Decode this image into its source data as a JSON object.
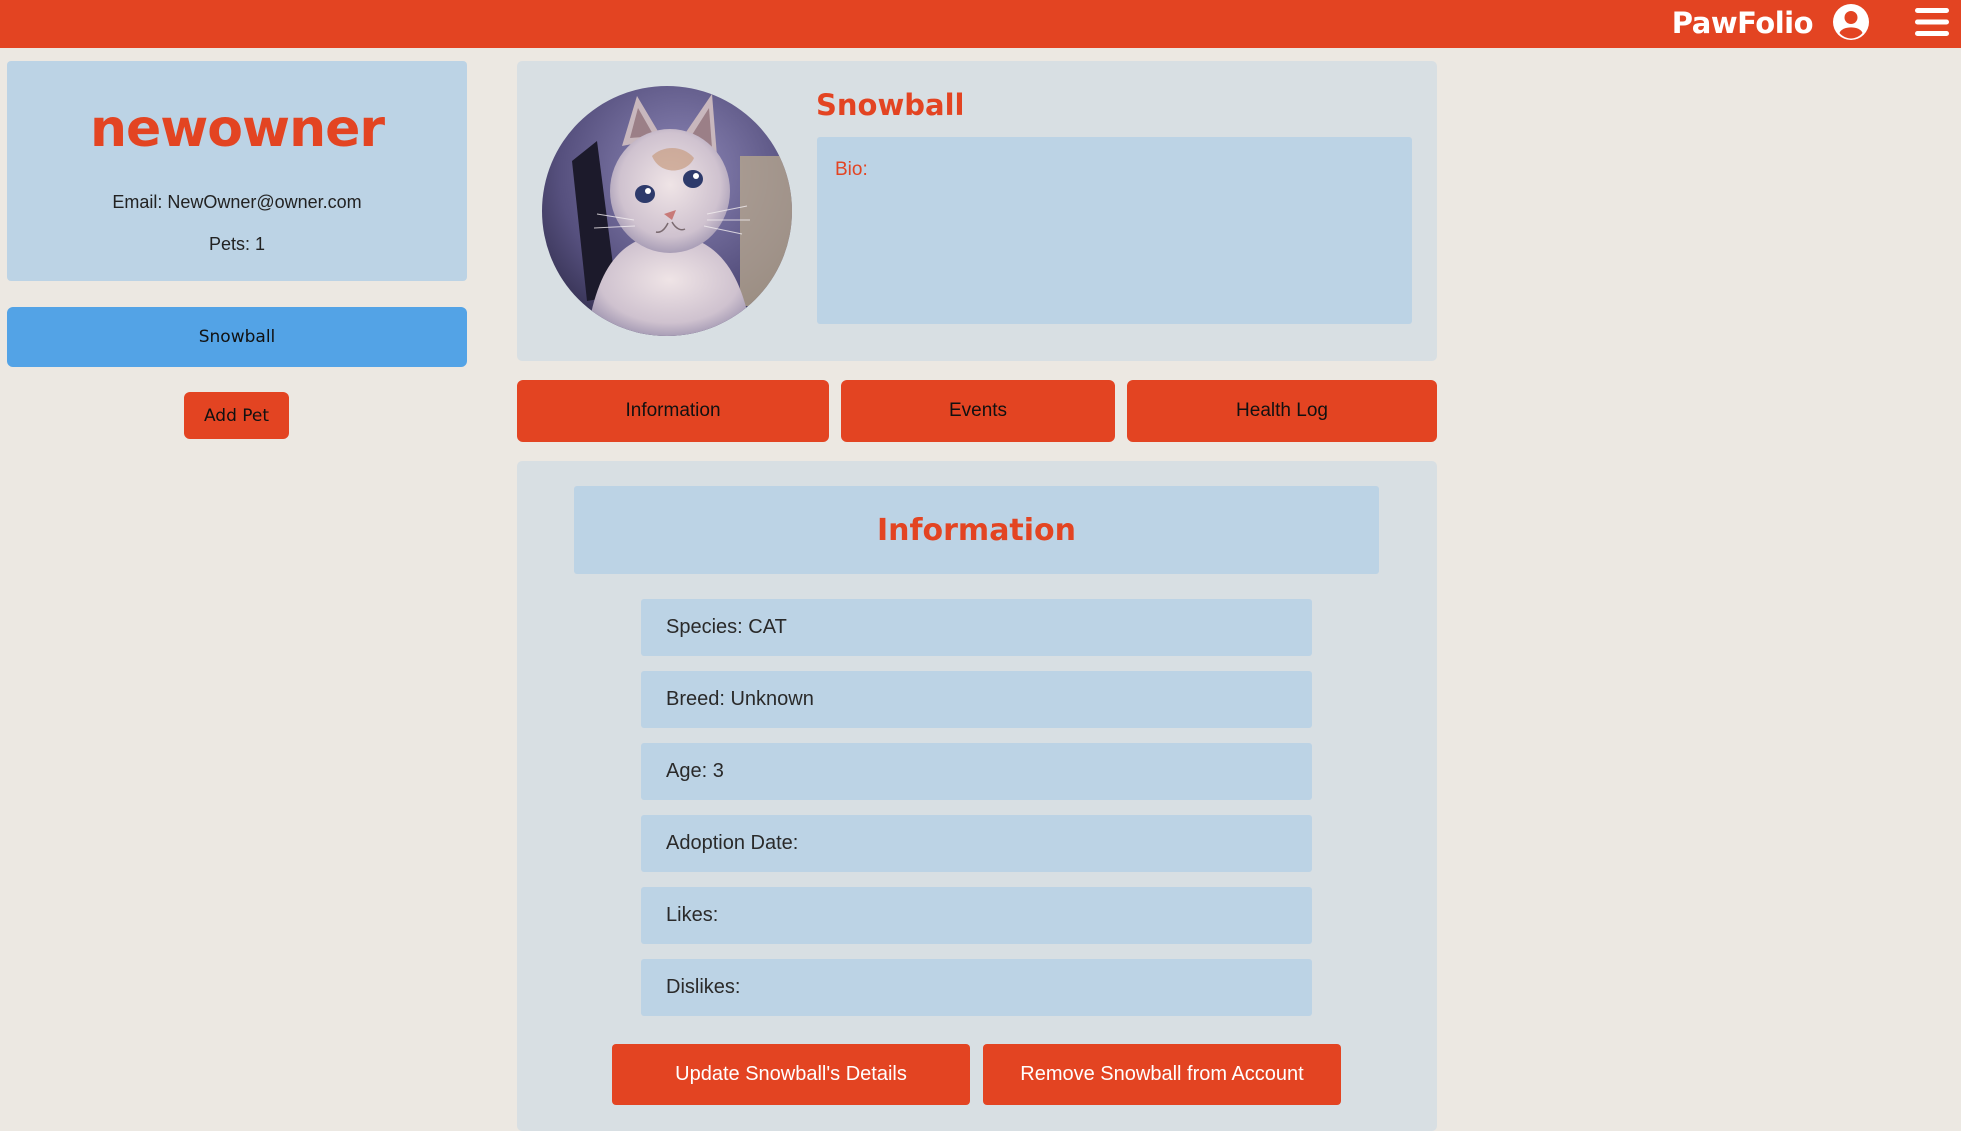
{
  "header": {
    "brand": "PawFolio",
    "icons": [
      "user-circle-icon",
      "hamburger-menu-icon"
    ],
    "accent_color": "#e34422"
  },
  "owner": {
    "name": "newowner",
    "email": "Email: NewOwner@owner.com",
    "pets": "Pets: 1"
  },
  "sidebar": {
    "pet_tabs": [
      {
        "label": "Snowball",
        "selected": true
      }
    ],
    "add_pet_label": "Add Pet"
  },
  "profile": {
    "pet_name": "Snowball",
    "bio_label": "Bio:",
    "photo_alt": "cat photo"
  },
  "tabs": [
    {
      "label": "Information"
    },
    {
      "label": "Events"
    },
    {
      "label": "Health Log"
    }
  ],
  "info": {
    "heading": "Information",
    "fields": [
      {
        "text": "Species: CAT"
      },
      {
        "text": "Breed: Unknown"
      },
      {
        "text": "Age: 3"
      },
      {
        "text": "Adoption Date:"
      },
      {
        "text": "Likes:"
      },
      {
        "text": "Dislikes:"
      }
    ],
    "update_label": "Update Snowball's Details",
    "remove_label": "Remove Snowball from Account"
  }
}
